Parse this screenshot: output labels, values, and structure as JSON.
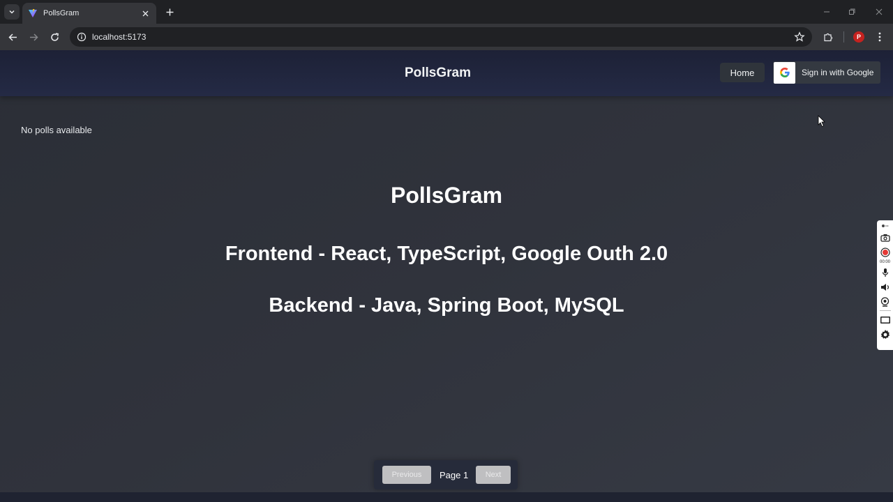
{
  "browser": {
    "tab_title": "PollsGram",
    "url": "localhost:5173",
    "profile_initial": "P",
    "icons": [
      "tab-search-icon",
      "close-icon",
      "plus-icon",
      "back-icon",
      "forward-icon",
      "reload-icon",
      "info-icon",
      "star-icon",
      "extensions-icon",
      "kebab-menu-icon",
      "minimize-icon",
      "maximize-icon"
    ]
  },
  "header": {
    "brand": "PollsGram",
    "home_label": "Home",
    "google_label": "Sign in with Google"
  },
  "main": {
    "empty_state": "No polls available",
    "hero_title": "PollsGram",
    "frontend_line": "Frontend - React, TypeScript, Google Outh 2.0",
    "backend_line": "Backend - Java, Spring Boot, MySQL"
  },
  "pagination": {
    "previous_label": "Previous",
    "page_label": "Page 1",
    "next_label": "Next"
  },
  "recorder": {
    "timer": "00:00"
  },
  "colors": {
    "header_bg": "#242a45",
    "page_bg": "#30333c",
    "button_disabled": "#bfbfc1",
    "profile": "#c5221f"
  }
}
